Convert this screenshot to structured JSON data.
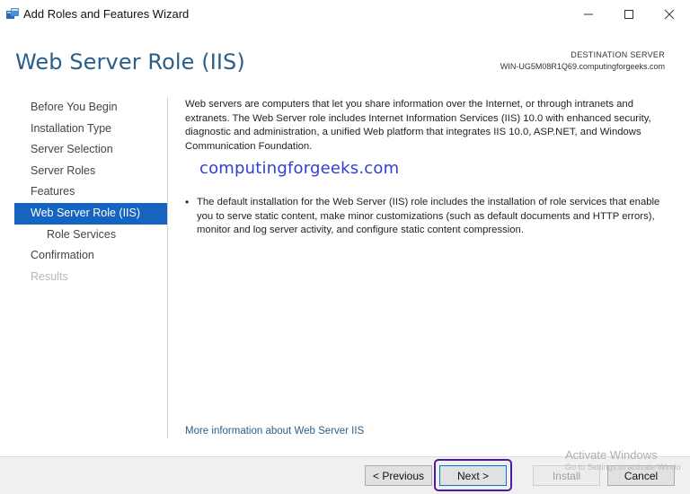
{
  "window": {
    "title": "Add Roles and Features Wizard",
    "icon": "server-manager-icon",
    "controls": [
      "minimize-icon",
      "maximize-icon",
      "close-icon"
    ]
  },
  "header": {
    "title": "Web Server Role (IIS)",
    "destination_label": "DESTINATION SERVER",
    "destination_server": "WIN-UG5M08R1Q69.computingforgeeks.com"
  },
  "nav": {
    "items": [
      {
        "label": "Before You Begin",
        "state": "normal"
      },
      {
        "label": "Installation Type",
        "state": "normal"
      },
      {
        "label": "Server Selection",
        "state": "normal"
      },
      {
        "label": "Server Roles",
        "state": "normal"
      },
      {
        "label": "Features",
        "state": "normal"
      },
      {
        "label": "Web Server Role (IIS)",
        "state": "active"
      },
      {
        "label": "Role Services",
        "state": "sub"
      },
      {
        "label": "Confirmation",
        "state": "normal"
      },
      {
        "label": "Results",
        "state": "disabled"
      }
    ]
  },
  "content": {
    "intro": "Web servers are computers that let you share information over the Internet, or through intranets and extranets. The Web Server role includes Internet Information Services (IIS) 10.0 with enhanced security, diagnostic and administration, a unified Web platform that integrates IIS 10.0, ASP.NET, and Windows Communication Foundation.",
    "watermark": "computingforgeeks.com",
    "bullet": "The default installation for the Web Server (IIS) role includes the installation of role services that enable you to serve static content, make minor customizations (such as default documents and HTTP errors), monitor and log server activity, and configure static content compression.",
    "more_link": "More information about Web Server IIS"
  },
  "footer": {
    "previous_label": "< Previous",
    "next_label": "Next >",
    "install_label": "Install",
    "cancel_label": "Cancel"
  },
  "activation": {
    "title": "Activate Windows",
    "subtitle": "Go to Settings to activate Windo"
  },
  "colors": {
    "accent": "#1565c0",
    "title_blue": "#2b5f8a",
    "highlight": "#4b1aa0",
    "watermark": "#2f3fd6"
  }
}
